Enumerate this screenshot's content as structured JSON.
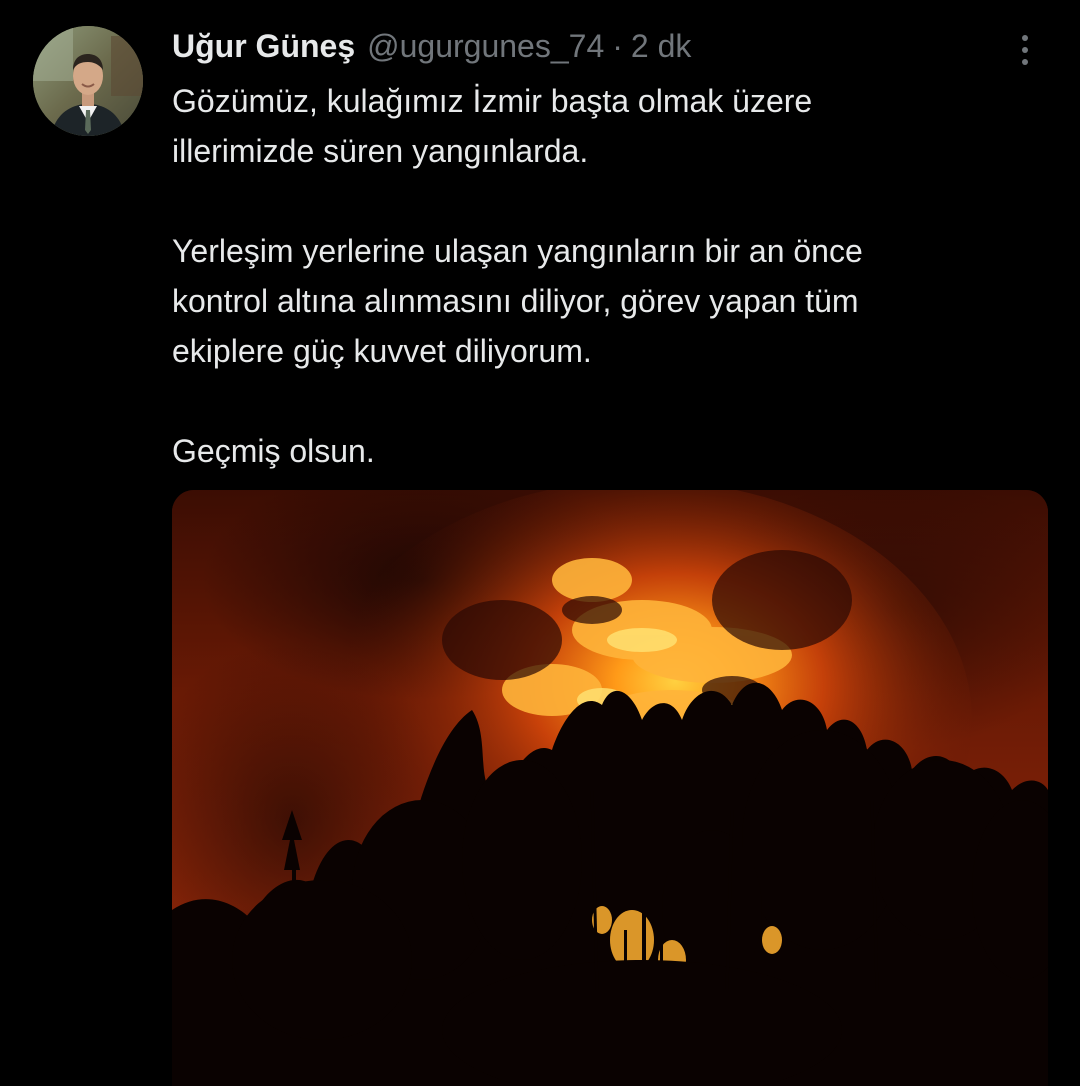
{
  "tweet": {
    "display_name": "Uğur Güneş",
    "handle": "@ugurgunes_74",
    "separator": "·",
    "time": "2 dk",
    "paragraphs": [
      "Gözümüz, kulağımız İzmir başta olmak üzere\nillerimizde süren yangınlarda.",
      "Yerleşim yerlerine ulaşan yangınların bir an önce\nkontrol altına alınmasını diliyor, görev yapan tüm\nekiplere güç kuvvet diliyorum.",
      "Geçmiş olsun."
    ]
  },
  "icons": {
    "more": "more-vertical-icon"
  },
  "colors": {
    "background": "#000000",
    "text_primary": "#e7e9ea",
    "text_secondary": "#71767b",
    "fire_orange": "#ff7a10",
    "fire_dark": "#5a1504"
  }
}
